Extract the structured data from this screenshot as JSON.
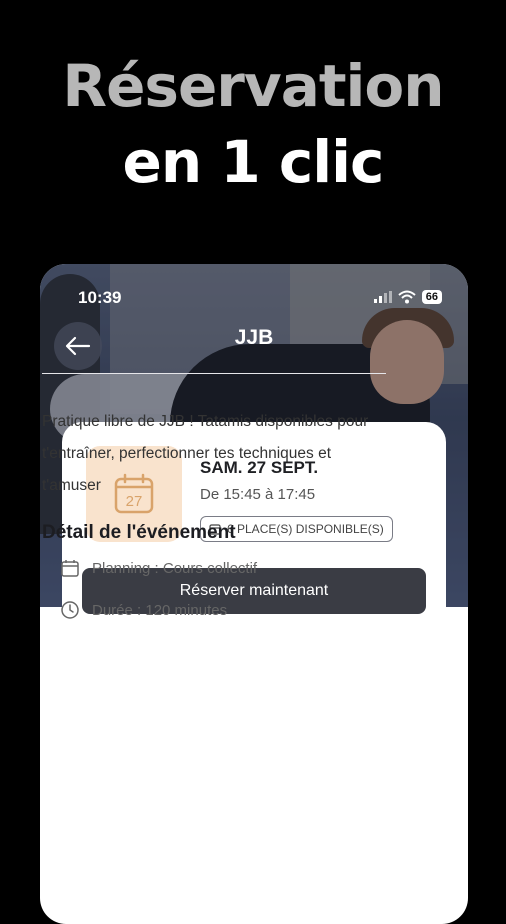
{
  "headline": {
    "line1": "Réservation",
    "line2": "en 1 clic"
  },
  "status_bar": {
    "time": "10:39",
    "battery": "66"
  },
  "nav": {
    "title": "JJB"
  },
  "event": {
    "calendar_day": "27",
    "date": "SAM. 27 SEPT.",
    "time_range": "De 15:45 à 17:45",
    "places": "6 PLACE(S) DISPONIBLE(S)",
    "reserve_label": "Réserver maintenant"
  },
  "description": "Pratique libre de JJB ! Tatamis disponibles pour t'entraîner, perfectionner tes techniques et t'amuser",
  "details": {
    "title": "Détail de l'événement",
    "planning": "Planning : Cours collectif",
    "duration": "Durée : 120 minutes"
  },
  "colors": {
    "accent_bg": "#f9e3cd",
    "accent": "#d9a36a",
    "button": "#3a3c44"
  }
}
